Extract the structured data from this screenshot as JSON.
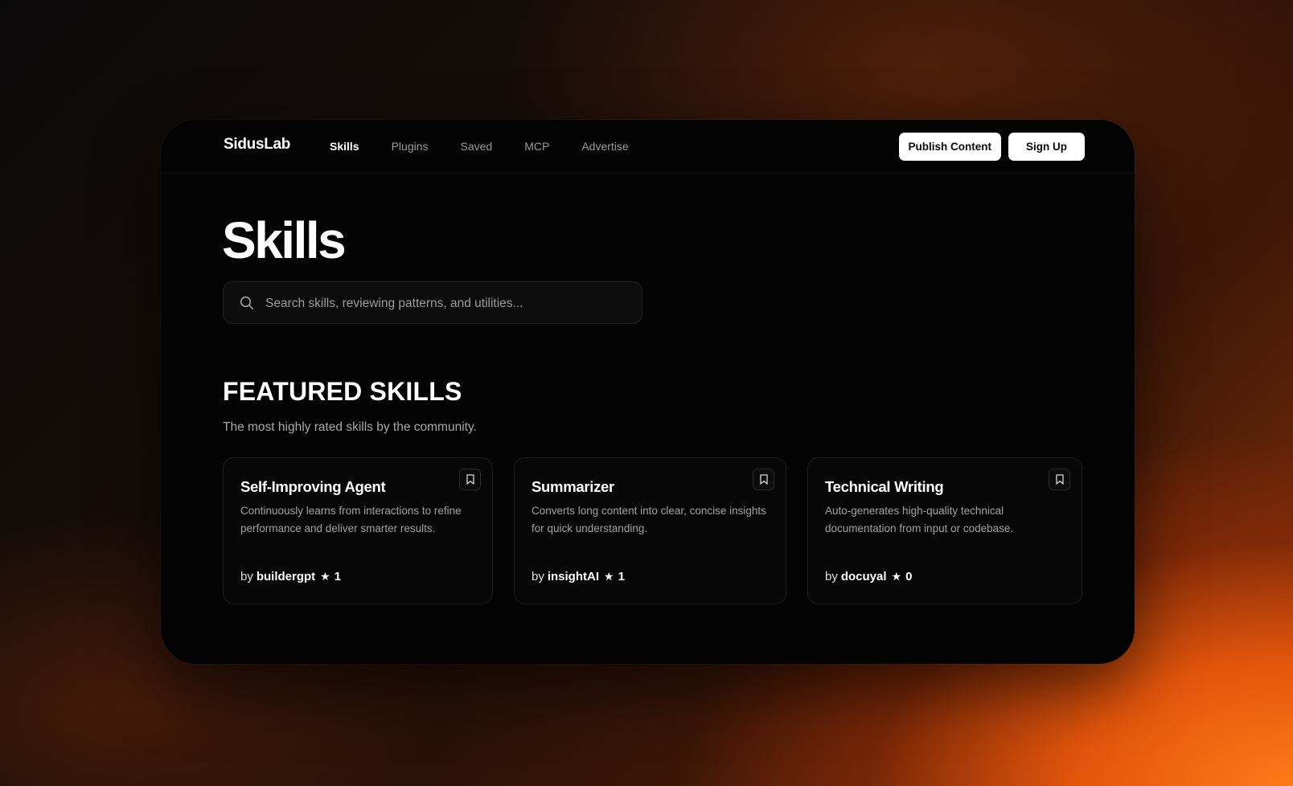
{
  "app": {
    "logo": "SidusLab"
  },
  "nav": {
    "links": [
      {
        "label": "Skills",
        "active": true
      },
      {
        "label": "Plugins",
        "active": false
      },
      {
        "label": "Saved",
        "active": false
      },
      {
        "label": "MCP",
        "active": false
      },
      {
        "label": "Advertise",
        "active": false
      }
    ],
    "publish_label": "Publish Content",
    "signup_label": "Sign Up"
  },
  "page": {
    "title": "Skills"
  },
  "search": {
    "placeholder": "Search skills, reviewing patterns, and utilities...",
    "value": "",
    "icon": "search-icon"
  },
  "featured": {
    "title": "FEATURED SKILLS",
    "subtitle": "The most highly rated skills by the community.",
    "cards": [
      {
        "title": "Self-Improving Agent",
        "description": "Continuously learns from interactions to refine performance and deliver smarter results.",
        "by_label": "by",
        "author": "buildergpt",
        "star": "★",
        "rating": "1"
      },
      {
        "title": "Summarizer",
        "description": "Converts long content into clear, concise insights for quick understanding.",
        "by_label": "by",
        "author": "insightAI",
        "star": "★",
        "rating": "1"
      },
      {
        "title": "Technical Writing",
        "description": "Auto-generates high-quality technical documentation from input or codebase.",
        "by_label": "by",
        "author": "docuyal",
        "star": "★",
        "rating": "0"
      }
    ]
  },
  "colors": {
    "window_bg": "#030303",
    "accent_orange": "#ff7a18",
    "text_primary": "#ffffff",
    "text_muted": "#a0a0a0"
  }
}
